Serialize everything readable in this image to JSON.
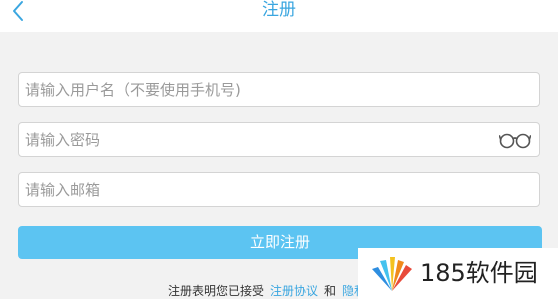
{
  "header": {
    "title": "注册",
    "back_icon": "chevron-left-icon"
  },
  "form": {
    "username_placeholder": "请输入用户名（不要使用手机号)",
    "password_placeholder": "请输入密码",
    "email_placeholder": "请输入邮箱",
    "password_toggle_icon": "glasses-icon",
    "submit_label": "立即注册"
  },
  "agreement": {
    "prefix": "注册表明您已接受",
    "terms_link": "注册协议",
    "and": "和",
    "privacy_link": "隐私保护"
  },
  "watermark": {
    "text": "185软件园"
  },
  "colors": {
    "accent": "#3aa6e0",
    "button": "#5cc4f2",
    "background": "#f2f2f2"
  }
}
